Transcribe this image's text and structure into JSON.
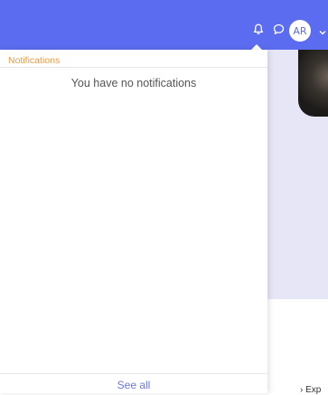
{
  "header": {
    "avatar_initials": "AR",
    "icons": [
      "bell-icon",
      "chat-icon",
      "chevron-down-icon"
    ],
    "color": "#5b6cf0"
  },
  "notifications": {
    "title": "Notifications",
    "empty_message": "You have no notifications",
    "see_all_label": "See all",
    "title_color": "#f29a3d",
    "link_color": "#6a76e6"
  },
  "background": {
    "explore_label": "Exp"
  }
}
